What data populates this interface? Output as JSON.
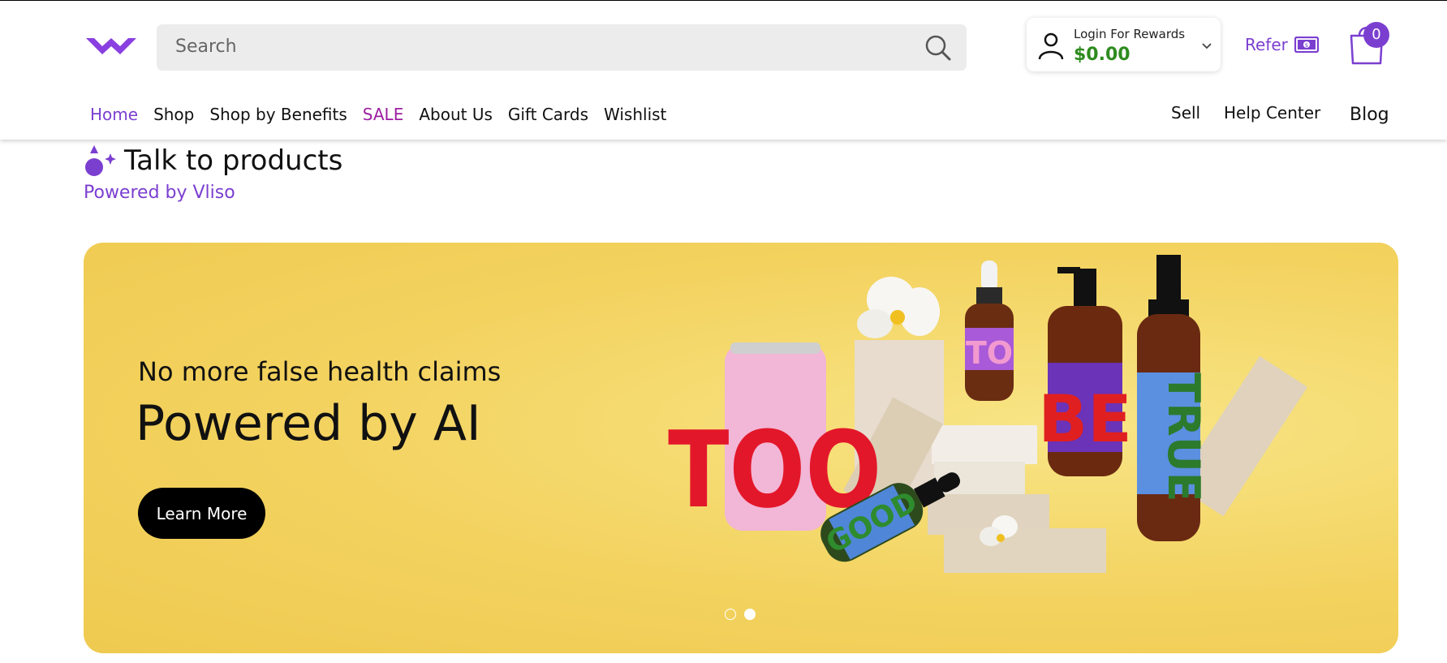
{
  "header": {
    "search": {
      "placeholder": "Search"
    },
    "login": {
      "label": "Login For Rewards",
      "amount": "$0.00"
    },
    "refer": {
      "label": "Refer"
    },
    "cart": {
      "count": "0"
    },
    "icons": [
      "brand-logo-icon",
      "search-icon",
      "user-icon",
      "chevron-down-icon",
      "cash-icon",
      "shopping-bag-icon"
    ]
  },
  "nav": {
    "items": [
      {
        "label": "Home"
      },
      {
        "label": "Shop"
      },
      {
        "label": "Shop by Benefits"
      },
      {
        "label": "SALE"
      },
      {
        "label": "About Us"
      },
      {
        "label": "Gift Cards"
      },
      {
        "label": "Wishlist"
      }
    ],
    "right": {
      "sell": "Sell",
      "help": "Help Center",
      "blog": "Blog"
    }
  },
  "talk": {
    "title": "Talk to products",
    "powered": "Powered by Vliso"
  },
  "banner": {
    "subtitle": "No more false health claims",
    "title": "Powered by AI",
    "button": "Learn More",
    "product_labels": [
      "TOO",
      "TO",
      "BE",
      "TRUE",
      "GOOD"
    ],
    "slides": 2,
    "active_slide": 2
  },
  "colors": {
    "brand_purple": "#7b3fd0",
    "sale_magenta": "#9b1fa0",
    "reward_green": "#2e8b1f",
    "banner_yellow": "#f3d25f"
  }
}
